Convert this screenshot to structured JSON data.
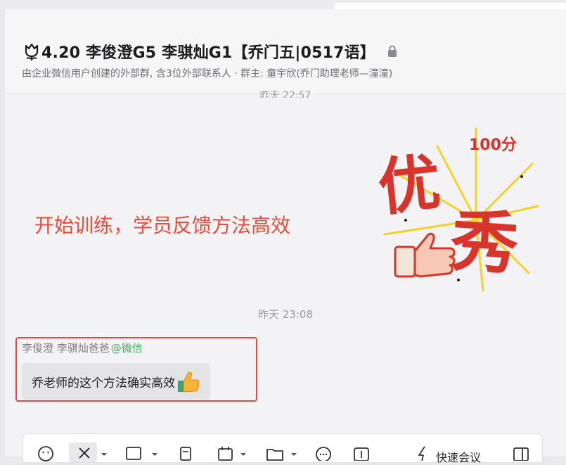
{
  "header": {
    "title": "4.20 李俊澄G5 李骐灿G1【乔门五|0517语】",
    "subtitle": "由企业微信用户创建的外部群, 含3位外部联系人 · 群主: 童宇欣(乔门助理老师—潼潼)",
    "icons": [
      "tulip-icon",
      "lock-icon"
    ]
  },
  "messages": {
    "time_partial": "昨天 22:57",
    "slogan": "开始训练，学员反馈方法高效",
    "sticker": {
      "score": "100分",
      "text": "优秀"
    },
    "time2": "昨天 23:08",
    "sender": {
      "name": "李俊澄 李骐灿爸爸",
      "tag": "@微信"
    },
    "bubble_text": "乔老师的这个方法确实高效",
    "bubble_emoji": "thumbs-up-icon"
  },
  "composer": {
    "quick_label": "快速会议",
    "tools": [
      "emoji-icon",
      "scissors-icon",
      "image-icon",
      "document-icon",
      "calendar-icon",
      "folder-icon",
      "chat-more-icon",
      "plus-box-icon",
      "lightning-icon",
      "sidebar-icon"
    ]
  },
  "colors": {
    "highlight": "#e24a43",
    "slogan": "#ea4b3c",
    "wechat_tag": "#3cb054"
  }
}
